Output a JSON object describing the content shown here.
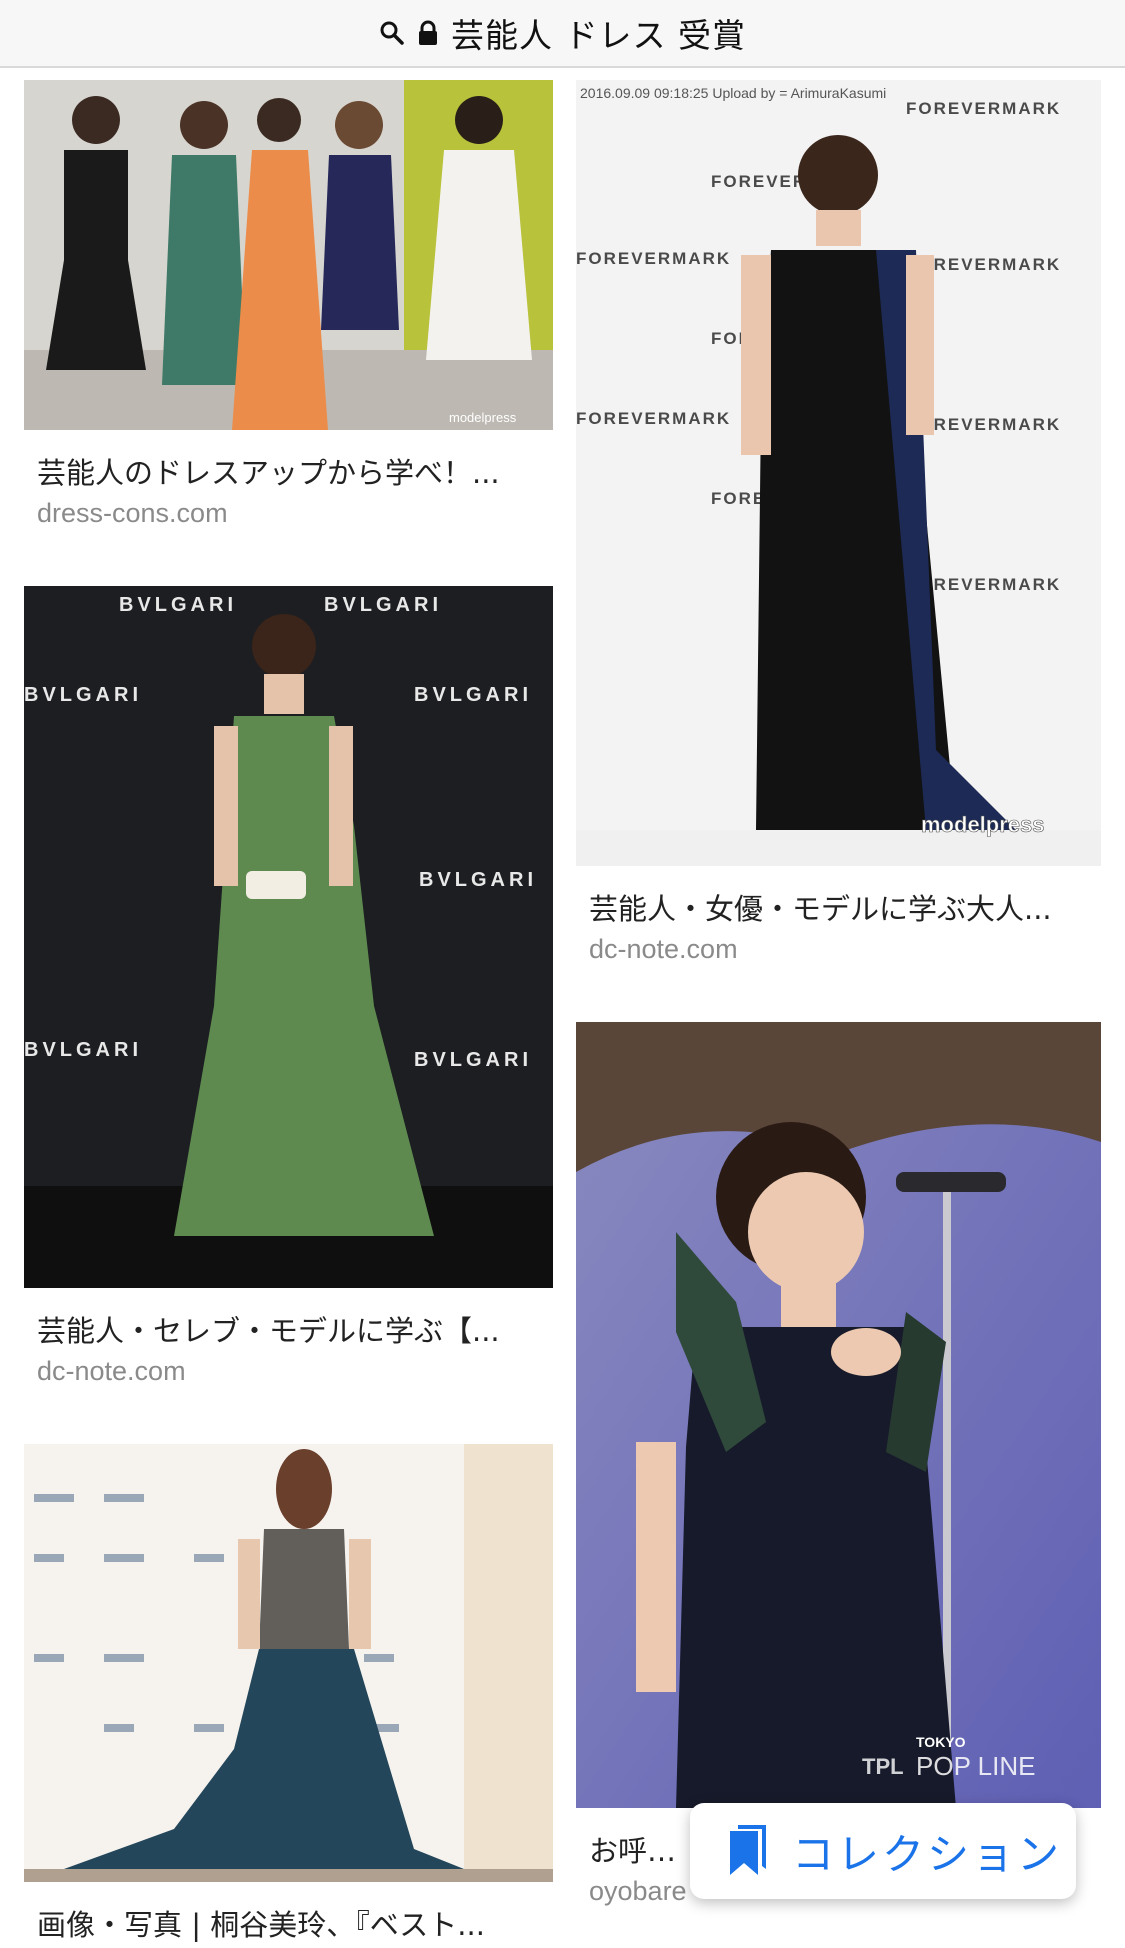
{
  "topbar": {
    "title": "芸能人 ドレス 受賞",
    "search_icon": "search-icon",
    "lock_icon": "lock-icon"
  },
  "results": [
    {
      "caption": "芸能人のドレスアップから学べ！...",
      "source": "dress-cons.com"
    },
    {
      "caption": "芸能人・女優・モデルに学ぶ大人...",
      "source": "dc-note.com"
    },
    {
      "caption": "芸能人・セレブ・モデルに学ぶ【...",
      "source": "dc-note.com"
    },
    {
      "caption": "お呼ばれ",
      "source": "oyobare"
    },
    {
      "caption": "画像・写真 | 桐谷美玲、『ベスト...",
      "source": ""
    }
  ],
  "image_text": {
    "forevermark": "FOREVERMARK",
    "bvlgari": "BVLGARI",
    "upload_stamp": "2016.09.09 09:18:25   Upload by = ArimuraKasumi",
    "modelpress": "modelpress",
    "tokyo": "TOKYO",
    "popline": "POP LINE",
    "tpl": "TPL"
  },
  "collection_button": {
    "label": "コレクション",
    "icon": "bookmark-icon",
    "color": "#1a73e8"
  }
}
